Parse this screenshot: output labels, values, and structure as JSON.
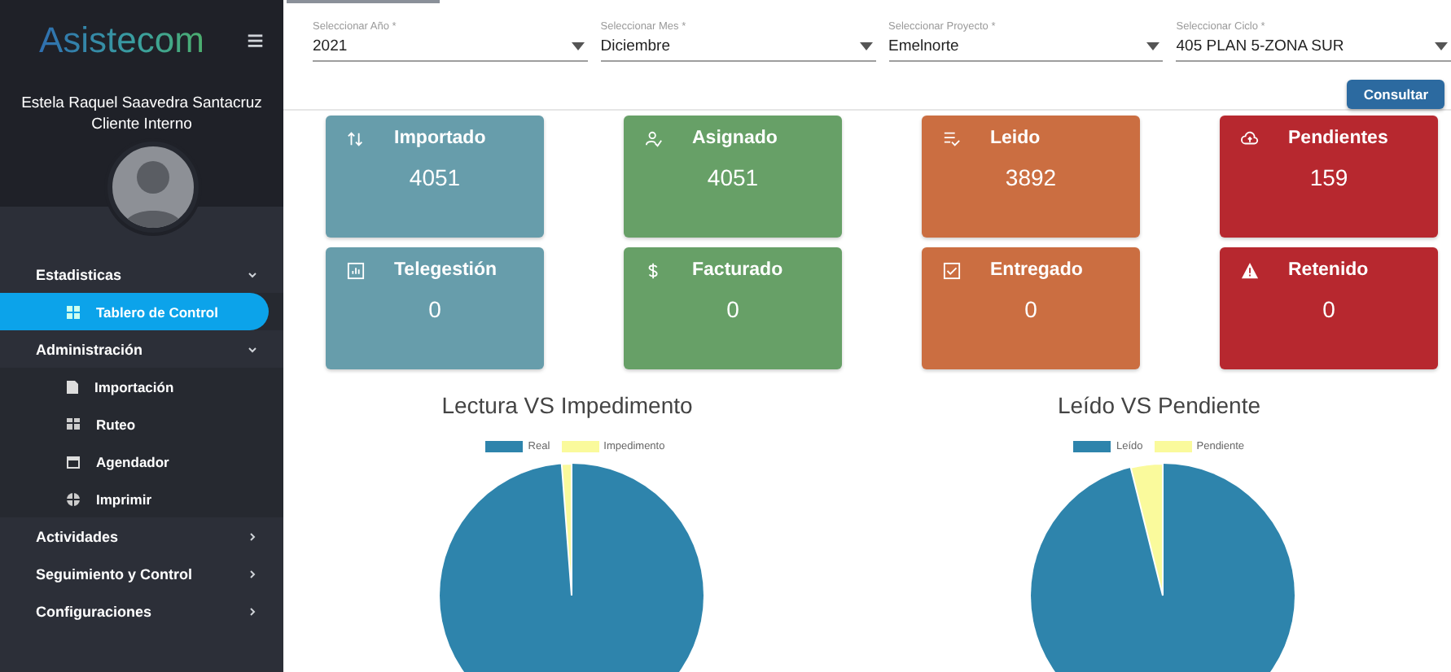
{
  "sidebar": {
    "logo": "Asistecom",
    "menu_icon": "≡",
    "user_name": "Estela Raquel Saavedra Santacruz",
    "user_role": "Cliente Interno",
    "items": [
      {
        "label": "Estadisticas",
        "expanded": true,
        "children": [
          {
            "label": "Tablero de Control",
            "selected": true
          }
        ]
      },
      {
        "label": "Administración",
        "expanded": true,
        "children": [
          {
            "label": "Importación",
            "selected": false
          },
          {
            "label": "Ruteo",
            "selected": false
          },
          {
            "label": "Agendador",
            "selected": false
          },
          {
            "label": "Imprimir",
            "selected": false
          }
        ]
      },
      {
        "label": "Actividades",
        "expanded": false
      },
      {
        "label": "Seguimiento y Control",
        "expanded": false
      },
      {
        "label": "Configuraciones",
        "expanded": false
      }
    ]
  },
  "filters": [
    {
      "label": "Seleccionar Año *",
      "value": "2021"
    },
    {
      "label": "Seleccionar Mes *",
      "value": "Diciembre"
    },
    {
      "label": "Seleccionar Proyecto *",
      "value": "Emelnorte"
    },
    {
      "label": "Seleccionar Ciclo *",
      "value": "405 PLAN 5-ZONA SUR"
    }
  ],
  "consult_button": "Consultar",
  "cards": [
    {
      "title": "Importado",
      "value": "4051",
      "color": "#679dab"
    },
    {
      "title": "Asignado",
      "value": "4051",
      "color": "#67a067"
    },
    {
      "title": "Leido",
      "value": "3892",
      "color": "#cb6e41"
    },
    {
      "title": "Pendientes",
      "value": "159",
      "color": "#b7282f"
    },
    {
      "title": "Telegestión",
      "value": "0",
      "color": "#679dab"
    },
    {
      "title": "Facturado",
      "value": "0",
      "color": "#67a067"
    },
    {
      "title": "Entregado",
      "value": "0",
      "color": "#cb6e41"
    },
    {
      "title": "Retenido",
      "value": "0",
      "color": "#b7282f"
    }
  ],
  "charts": [
    {
      "title": "Lectura VS Impedimento",
      "legend": [
        {
          "label": "Real",
          "color": "#2e84ac"
        },
        {
          "label": "Impedimento",
          "color": "#fafa9c"
        }
      ]
    },
    {
      "title": "Leído VS Pendiente",
      "legend": [
        {
          "label": "Leído",
          "color": "#2e84ac"
        },
        {
          "label": "Pendiente",
          "color": "#fafa9c"
        }
      ]
    }
  ]
}
